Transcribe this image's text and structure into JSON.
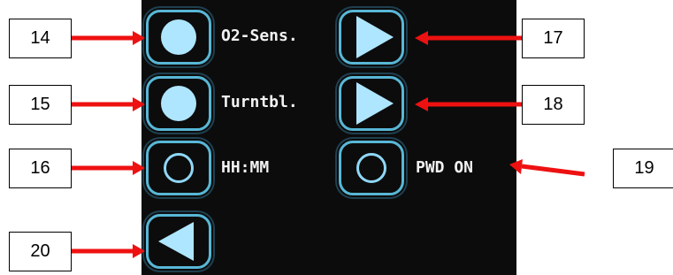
{
  "callouts": [
    "14",
    "15",
    "16",
    "17",
    "18",
    "19",
    "20"
  ],
  "display": {
    "labels": {
      "o2_sensor": "O2-Sens.",
      "turntable": "Turntbl.",
      "time": "HH:MM",
      "pwd": "PWD ON"
    }
  },
  "colors": {
    "screen_background": "#0c0c0c",
    "button_border": "#58b7d6",
    "icon_fill": "#aee6ff",
    "arrow": "#ee1111",
    "label_text": "#f2f2f2"
  },
  "icons": {
    "filled_circle": "circle-filled-icon",
    "outline_circle": "circle-outline-icon",
    "right_arrow": "play-right-icon",
    "left_arrow": "back-left-icon"
  }
}
